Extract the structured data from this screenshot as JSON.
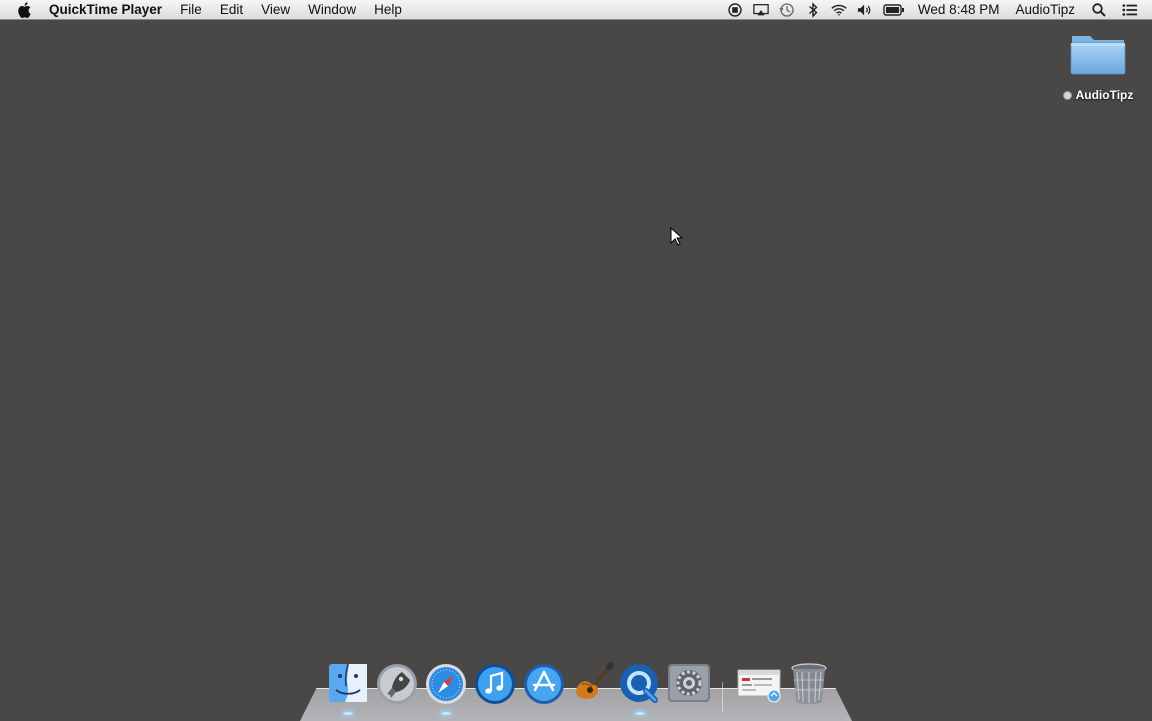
{
  "menubar": {
    "app_name": "QuickTime Player",
    "menus": [
      "File",
      "Edit",
      "View",
      "Window",
      "Help"
    ],
    "status_icons": [
      "record-icon",
      "airplay-icon",
      "time-machine-icon",
      "bluetooth-icon",
      "wifi-icon",
      "volume-icon",
      "battery-icon"
    ],
    "clock": "Wed 8:48 PM",
    "user": "AudioTipz"
  },
  "desktop": {
    "icons": [
      {
        "label": "AudioTipz",
        "icon": "folder-icon"
      }
    ]
  },
  "dock": {
    "apps": [
      "finder-icon",
      "launchpad-icon",
      "safari-icon",
      "itunes-icon",
      "app-store-icon",
      "garageband-icon",
      "quicktime-icon",
      "system-preferences-icon",
      "preview-icon",
      "trash-icon"
    ]
  },
  "colors": {
    "desktop_background": "#4a4747",
    "menubar_background": "#e8e8e8"
  }
}
